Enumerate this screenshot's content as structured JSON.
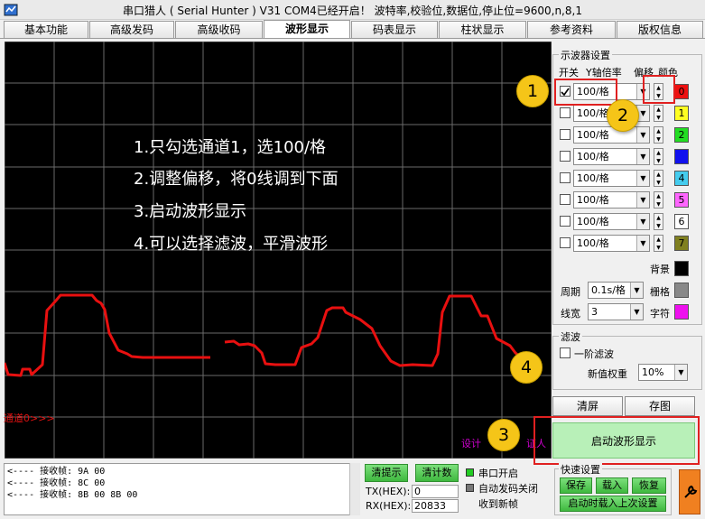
{
  "window": {
    "title": "串口猎人 ( Serial Hunter ) V31    COM4已经开启！ 波特率,校验位,数据位,停止位=9600,n,8,1"
  },
  "tabs": [
    "基本功能",
    "高级发码",
    "高级收码",
    "波形显示",
    "码表显示",
    "柱状显示",
    "参考资料",
    "版权信息"
  ],
  "scope": {
    "instructions": [
      "1.只勾选通道1，选100/格",
      "2.调整偏移，将0线调到下面",
      "3.启动波形显示",
      "4.可以选择滤波，平滑波形"
    ],
    "channel_label": "通道0>>>",
    "design_left": "设计",
    "design_right": "证人"
  },
  "settings": {
    "title": "示波器设置",
    "col_switch": "开关",
    "col_scale": "Y轴倍率",
    "col_offset": "偏移",
    "col_color": "颜色",
    "channels": [
      {
        "checked": true,
        "scale": "100/格",
        "color": "#ee1111",
        "label": "0"
      },
      {
        "checked": false,
        "scale": "100/格",
        "color": "#ffff22",
        "label": "1"
      },
      {
        "checked": false,
        "scale": "100/格",
        "color": "#22dd22",
        "label": "2"
      },
      {
        "checked": false,
        "scale": "100/格",
        "color": "#1111ee",
        "label": "3"
      },
      {
        "checked": false,
        "scale": "100/格",
        "color": "#44ccee",
        "label": "4"
      },
      {
        "checked": false,
        "scale": "100/格",
        "color": "#ff66ff",
        "label": "5"
      },
      {
        "checked": false,
        "scale": "100/格",
        "color": "#ffffff",
        "label": "6"
      },
      {
        "checked": false,
        "scale": "100/格",
        "color": "#808020",
        "label": "7"
      }
    ],
    "bg_label": "背景",
    "bg_color": "#000000",
    "period_label": "周期",
    "period_value": "0.1s/格",
    "grid_label": "栅格",
    "grid_color": "#888888",
    "linewidth_label": "线宽",
    "linewidth_value": "3",
    "char_label": "字符",
    "char_color": "#ee11ee"
  },
  "filter": {
    "title": "滤波",
    "first_order": "一阶滤波",
    "weight_label": "新值权重",
    "weight_value": "10%"
  },
  "actions": {
    "clear": "清屏",
    "save_image": "存图",
    "start_wave": "启动波形显示"
  },
  "callouts": [
    "1",
    "2",
    "3",
    "4"
  ],
  "bottom": {
    "log_lines": [
      "<---- 接收帧: 9A 00",
      "<---- 接收帧: 8C 00",
      "<---- 接收帧: 8B 00 8B 00"
    ],
    "clear_hint": "清提示",
    "clear_count": "清计数",
    "tx_label": "TX(HEX):",
    "tx_value": "0",
    "rx_label": "RX(HEX):",
    "rx_value": "20833",
    "port_open": "串口开启",
    "auto_close": "自动发码关闭",
    "new_frame": "收到新帧",
    "quick_title": "快速设置",
    "save": "保存",
    "load": "载入",
    "restore": "恢复",
    "startup_load": "启动时载入上次设置"
  },
  "icons": {
    "app": "app-icon",
    "tool": "wrench-icon"
  }
}
